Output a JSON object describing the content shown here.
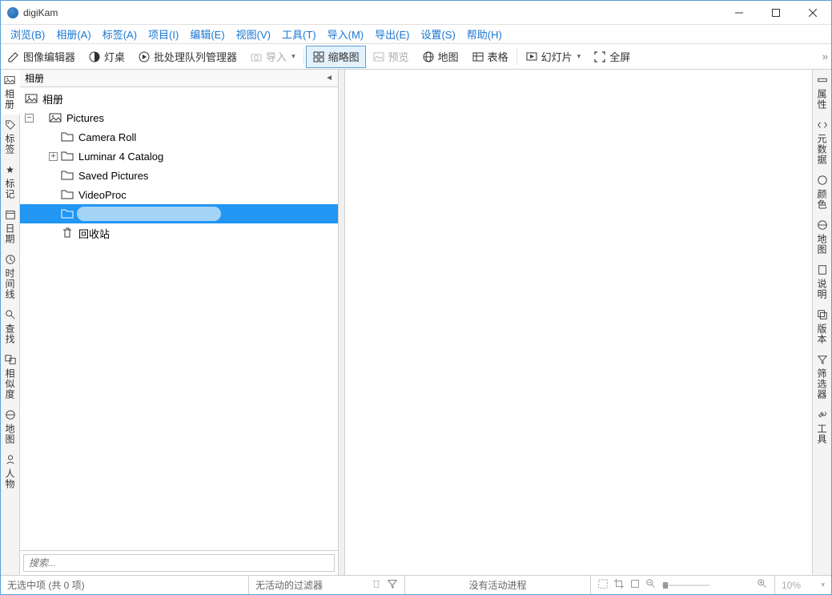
{
  "titlebar": {
    "title": "digiKam"
  },
  "menubar": {
    "items": [
      "浏览(B)",
      "相册(A)",
      "标签(A)",
      "项目(I)",
      "编辑(E)",
      "视图(V)",
      "工具(T)",
      "导入(M)",
      "导出(E)",
      "设置(S)",
      "帮助(H)"
    ]
  },
  "toolbar": {
    "image_editor": "图像编辑器",
    "light_table": "灯桌",
    "batch_queue": "批处理队列管理器",
    "import": "导入",
    "thumbnails": "缩略图",
    "preview": "预览",
    "map": "地图",
    "table": "表格",
    "slideshow": "幻灯片",
    "fullscreen": "全屏"
  },
  "left_rail": {
    "tabs": [
      "相册",
      "标签",
      "标记",
      "日期",
      "时间线",
      "查找",
      "相似度",
      "地图",
      "人物"
    ]
  },
  "right_rail": {
    "tabs": [
      "属性",
      "元数据",
      "颜色",
      "地图",
      "说明",
      "版本",
      "筛选器",
      "工具"
    ]
  },
  "sidebar": {
    "header": "相册",
    "root_label": "相册",
    "pictures_label": "Pictures",
    "items": [
      {
        "label": "Camera Roll"
      },
      {
        "label": "Luminar 4 Catalog"
      },
      {
        "label": "Saved Pictures"
      },
      {
        "label": "VideoProc"
      }
    ],
    "trash_label": "回收站",
    "search_placeholder": "搜索..."
  },
  "status": {
    "selection": "无选中项 (共 0 项)",
    "filter": "无活动的过滤器",
    "progress": "没有活动进程",
    "zoom": "10%"
  }
}
